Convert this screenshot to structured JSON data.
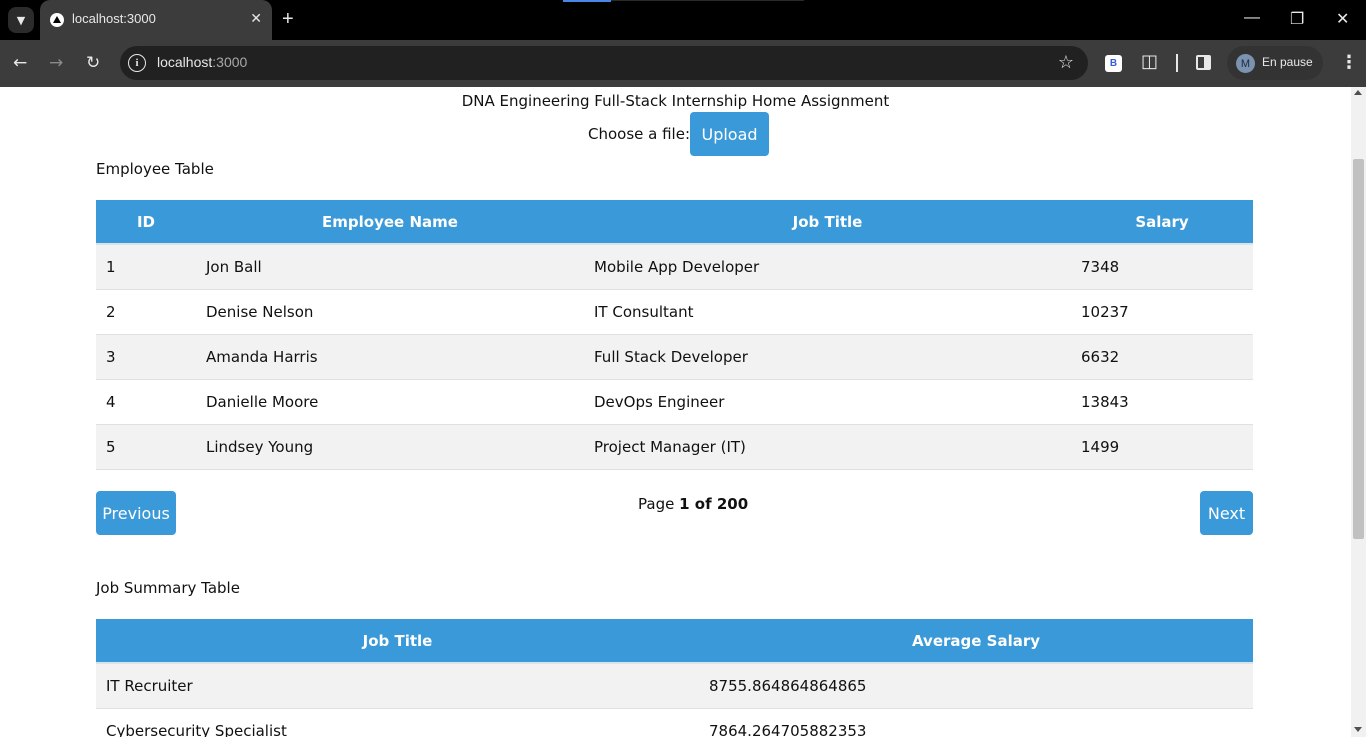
{
  "browser": {
    "tab_title": "localhost:3000",
    "url_host": "localhost",
    "url_port": ":3000",
    "profile_initial": "M",
    "profile_label": "En pause",
    "extension_letter": "B"
  },
  "page": {
    "heading": "DNA Engineering Full-Stack Internship Home Assignment",
    "upload_label": "Choose a file:",
    "upload_button": "Upload"
  },
  "employee_table": {
    "title": "Employee Table",
    "columns": [
      "ID",
      "Employee Name",
      "Job Title",
      "Salary"
    ],
    "rows": [
      [
        "1",
        "Jon Ball",
        "Mobile App Developer",
        "7348"
      ],
      [
        "2",
        "Denise Nelson",
        "IT Consultant",
        "10237"
      ],
      [
        "3",
        "Amanda Harris",
        "Full Stack Developer",
        "6632"
      ],
      [
        "4",
        "Danielle Moore",
        "DevOps Engineer",
        "13843"
      ],
      [
        "5",
        "Lindsey Young",
        "Project Manager (IT)",
        "1499"
      ]
    ]
  },
  "pagination": {
    "previous_label": "Previous",
    "next_label": "Next",
    "page_prefix": "Page",
    "page_current": "1 of 200"
  },
  "job_table": {
    "title": "Job Summary Table",
    "columns": [
      "Job Title",
      "Average Salary"
    ],
    "rows": [
      [
        "IT Recruiter",
        "8755.864864864865"
      ],
      [
        "Cybersecurity Specialist",
        "7864.264705882353"
      ]
    ]
  },
  "colors": {
    "accent": "#3a99d8",
    "row_stripe": "#f2f2f2"
  }
}
